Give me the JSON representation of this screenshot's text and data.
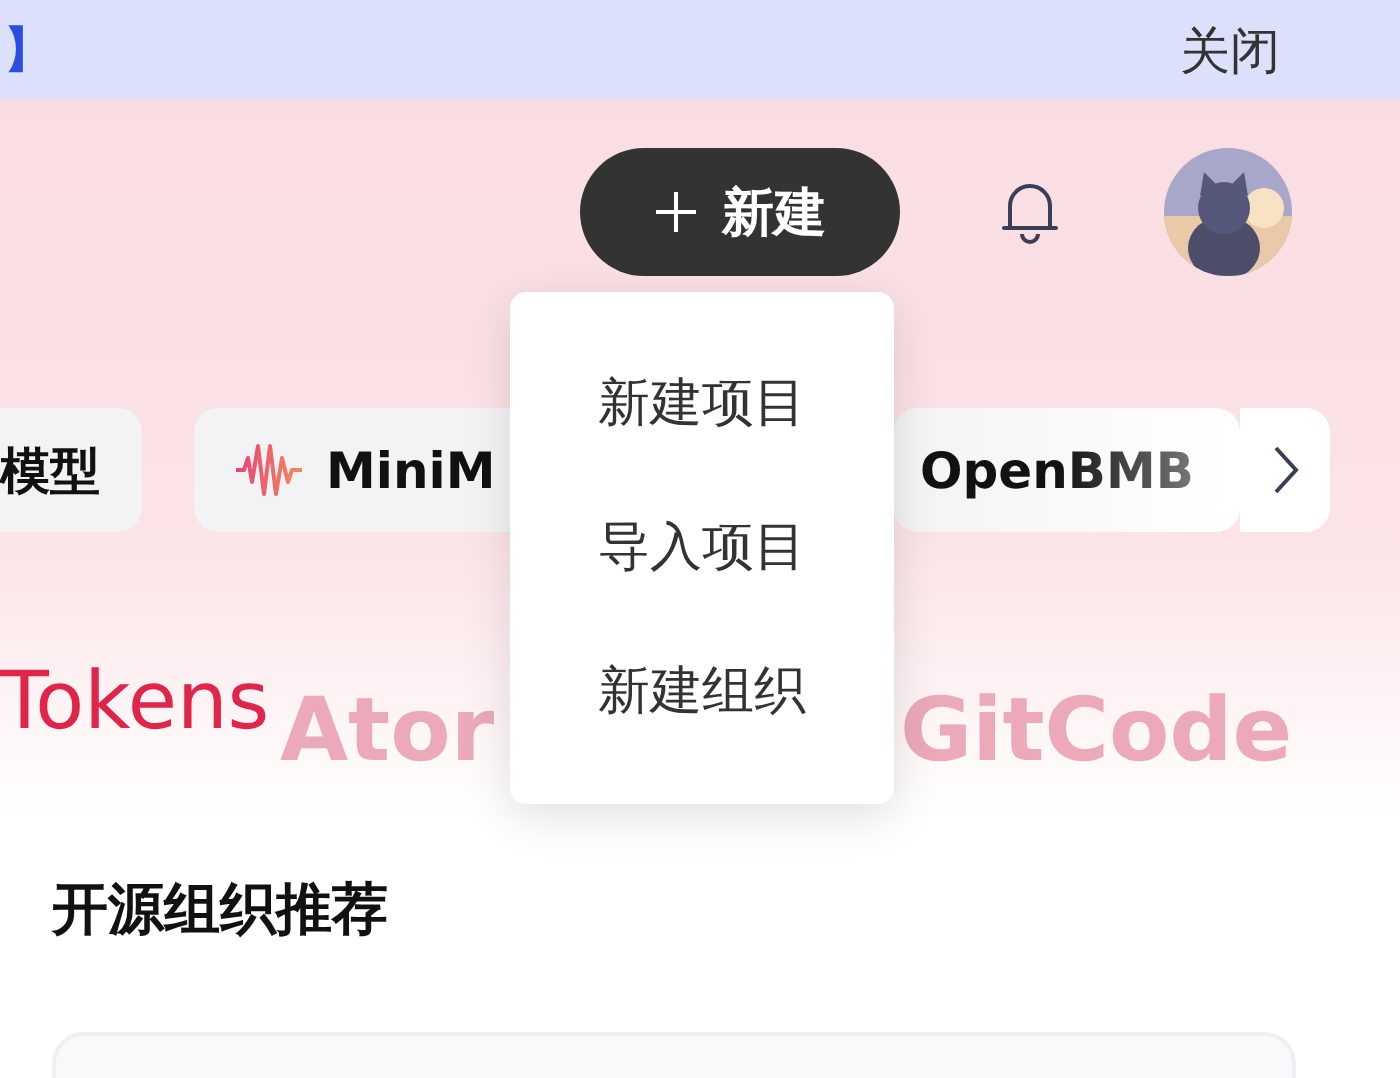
{
  "banner": {
    "link_fragment": "】",
    "close": "关闭"
  },
  "header": {
    "new_button": {
      "label": "新建"
    }
  },
  "new_menu": {
    "items": [
      {
        "label": "新建项目"
      },
      {
        "label": "导入项目"
      },
      {
        "label": "新建组织"
      }
    ]
  },
  "models": {
    "chips": [
      {
        "label": "模型",
        "kind": "text"
      },
      {
        "label": "MiniM",
        "kind": "wave"
      },
      {
        "label": "OpenBMB",
        "kind": "faded"
      }
    ]
  },
  "hero": {
    "backdrop_words": [
      "Ator",
      "GitCode"
    ],
    "tokens_text": "Tokens"
  },
  "section": {
    "title": "开源组织推荐"
  }
}
